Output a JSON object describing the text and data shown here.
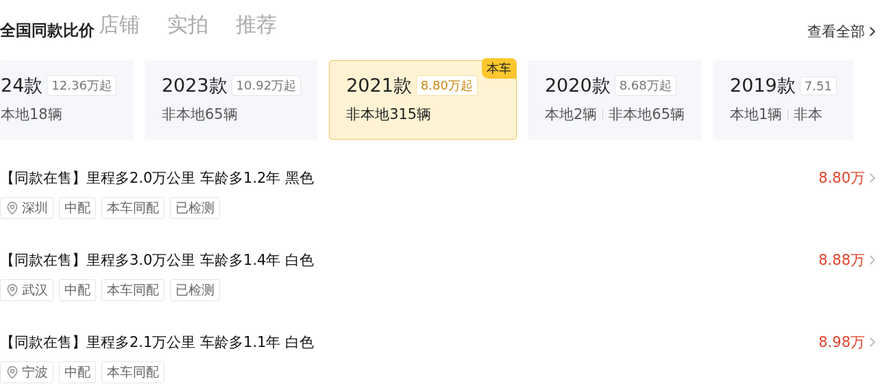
{
  "header": {
    "title": "全国同款比价",
    "tabs": [
      {
        "label": "店铺"
      },
      {
        "label": "实拍"
      },
      {
        "label": "推荐"
      }
    ],
    "view_all": "查看全部"
  },
  "models": [
    {
      "year": "24款",
      "price": "12.36万起",
      "counts": [
        "本地18辆"
      ],
      "selected": false
    },
    {
      "year": "2023款",
      "price": "10.92万起",
      "counts": [
        "非本地65辆"
      ],
      "selected": false
    },
    {
      "year": "2021款",
      "price": "8.80万起",
      "counts": [
        "非本地315辆"
      ],
      "selected": true,
      "badge": "本车"
    },
    {
      "year": "2020款",
      "price": "8.68万起",
      "counts": [
        "本地2辆",
        "非本地65辆"
      ],
      "selected": false
    },
    {
      "year": "2019款",
      "price": "7.51",
      "counts": [
        "本地1辆",
        "非本"
      ],
      "selected": false
    }
  ],
  "listings": [
    {
      "title": "【同款在售】里程多2.0万公里 车龄多1.2年 黑色",
      "price": "8.80万",
      "city": "深圳",
      "tags": [
        "中配",
        "本车同配",
        "已检测"
      ]
    },
    {
      "title": "【同款在售】里程多3.0万公里 车龄多1.4年 白色",
      "price": "8.88万",
      "city": "武汉",
      "tags": [
        "中配",
        "本车同配",
        "已检测"
      ]
    },
    {
      "title": "【同款在售】里程多2.1万公里 车龄多1.1年 白色",
      "price": "8.98万",
      "city": "宁波",
      "tags": [
        "中配",
        "本车同配"
      ]
    }
  ]
}
